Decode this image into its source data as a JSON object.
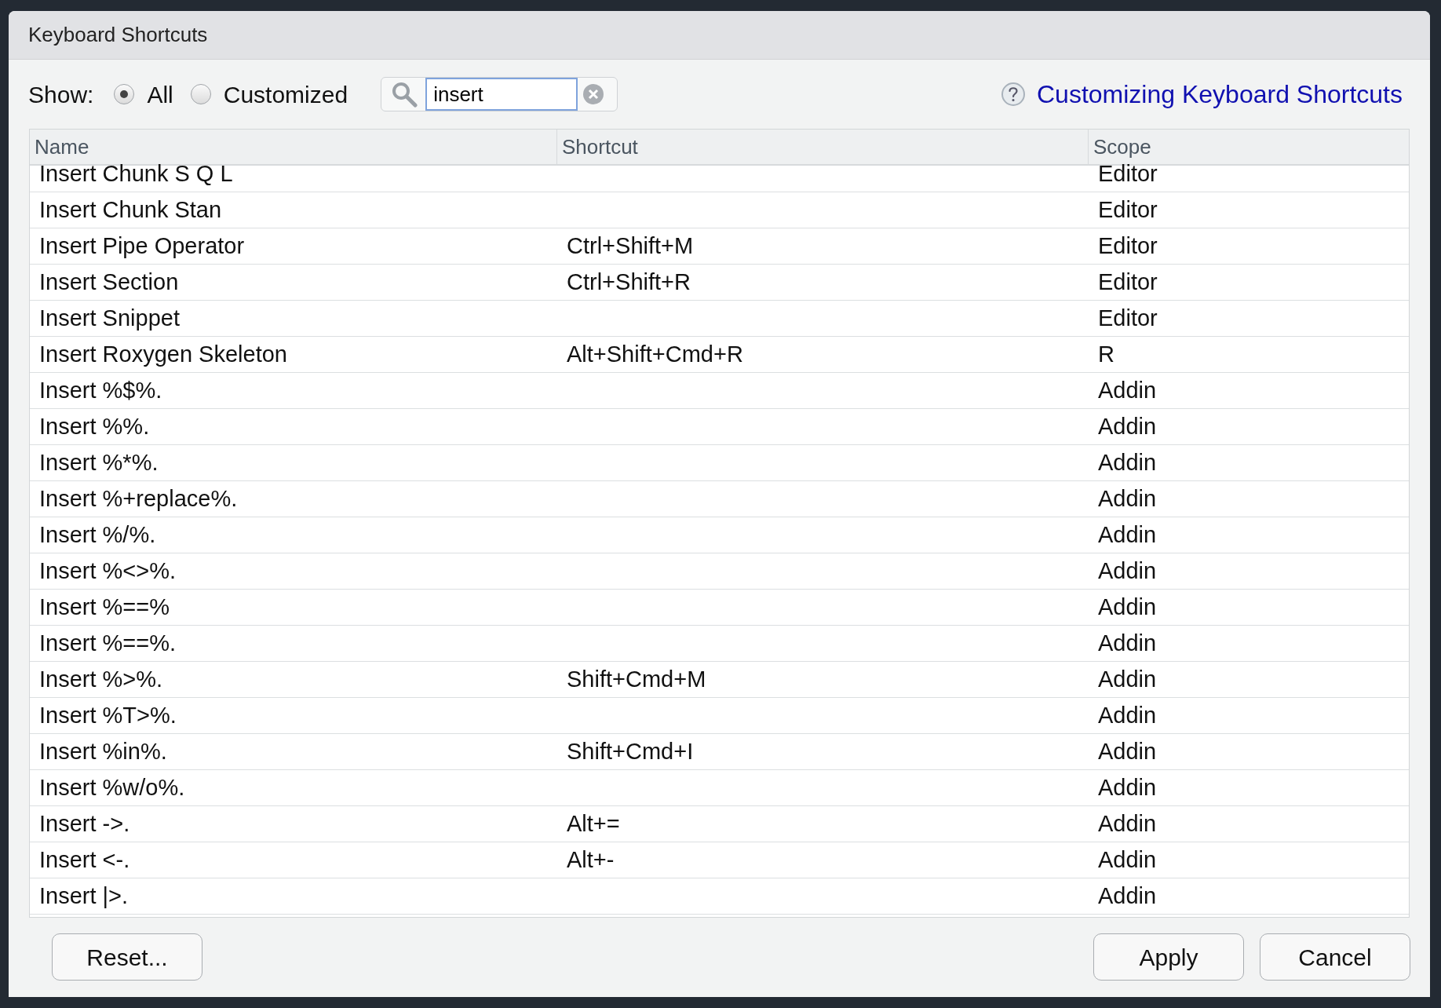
{
  "window": {
    "title": "Keyboard Shortcuts"
  },
  "show": {
    "label": "Show:",
    "options": [
      {
        "label": "All",
        "selected": true
      },
      {
        "label": "Customized",
        "selected": false
      }
    ]
  },
  "search": {
    "value": "insert"
  },
  "help_link": "Customizing Keyboard Shortcuts",
  "table": {
    "columns": [
      "Name",
      "Shortcut",
      "Scope"
    ],
    "rows": [
      {
        "name": "Insert Chunk S Q L",
        "shortcut": "",
        "scope": "Editor"
      },
      {
        "name": "Insert Chunk Stan",
        "shortcut": "",
        "scope": "Editor"
      },
      {
        "name": "Insert Pipe Operator",
        "shortcut": "Ctrl+Shift+M",
        "scope": "Editor"
      },
      {
        "name": "Insert Section",
        "shortcut": "Ctrl+Shift+R",
        "scope": "Editor"
      },
      {
        "name": "Insert Snippet",
        "shortcut": "",
        "scope": "Editor"
      },
      {
        "name": "Insert Roxygen Skeleton",
        "shortcut": "Alt+Shift+Cmd+R",
        "scope": "R"
      },
      {
        "name": "Insert %$%.",
        "shortcut": "",
        "scope": "Addin"
      },
      {
        "name": "Insert %%.",
        "shortcut": "",
        "scope": "Addin"
      },
      {
        "name": "Insert %*%.",
        "shortcut": "",
        "scope": "Addin"
      },
      {
        "name": "Insert %+replace%.",
        "shortcut": "",
        "scope": "Addin"
      },
      {
        "name": "Insert %/%.",
        "shortcut": "",
        "scope": "Addin"
      },
      {
        "name": "Insert %<>%.",
        "shortcut": "",
        "scope": "Addin"
      },
      {
        "name": "Insert %==%",
        "shortcut": "",
        "scope": "Addin"
      },
      {
        "name": "Insert %==%.",
        "shortcut": "",
        "scope": "Addin"
      },
      {
        "name": "Insert %>%.",
        "shortcut": "Shift+Cmd+M",
        "scope": "Addin"
      },
      {
        "name": "Insert %T>%.",
        "shortcut": "",
        "scope": "Addin"
      },
      {
        "name": "Insert %in%.",
        "shortcut": "Shift+Cmd+I",
        "scope": "Addin"
      },
      {
        "name": "Insert %w/o%.",
        "shortcut": "",
        "scope": "Addin"
      },
      {
        "name": "Insert ->.",
        "shortcut": "Alt+=",
        "scope": "Addin"
      },
      {
        "name": "Insert <-.",
        "shortcut": "Alt+-",
        "scope": "Addin"
      },
      {
        "name": "Insert |>.",
        "shortcut": "",
        "scope": "Addin"
      }
    ]
  },
  "buttons": {
    "left": [
      "Reset..."
    ],
    "right": [
      "Apply",
      "Cancel"
    ]
  }
}
